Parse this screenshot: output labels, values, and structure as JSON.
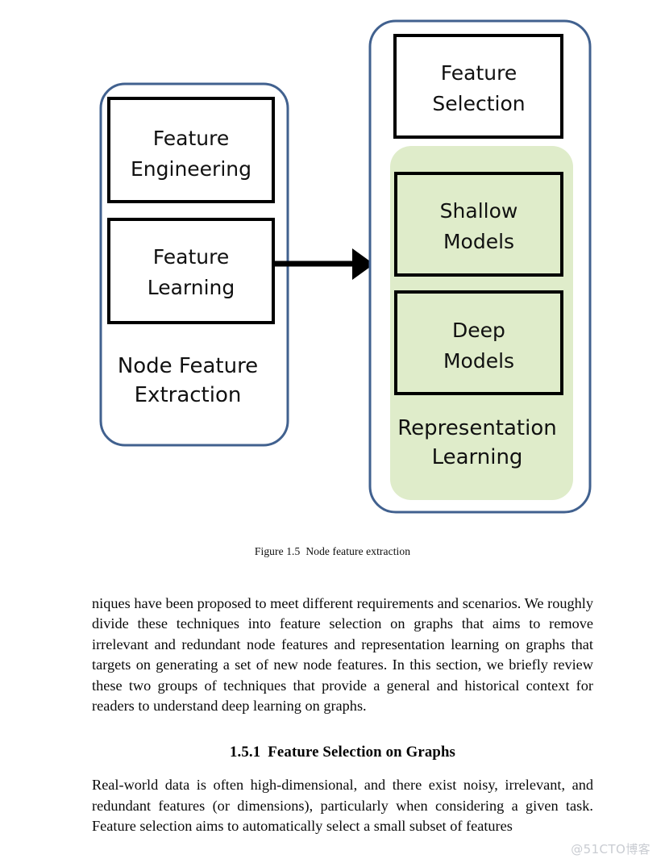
{
  "figure": {
    "caption_number": "Figure 1.5",
    "caption_text": "Node feature extraction",
    "colors": {
      "container_border": "#41618f",
      "group_fill": "#dfecca",
      "box_border": "#000000",
      "box_fill": "#ffffff",
      "arrow": "#000000"
    },
    "left_container": {
      "name": "Node Feature Extraction",
      "footer_label_line1": "Node Feature",
      "footer_label_line2": "Extraction",
      "boxes": [
        {
          "line1": "Feature",
          "line2": "Engineering"
        },
        {
          "line1": "Feature",
          "line2": "Learning"
        }
      ]
    },
    "right_container": {
      "boxes": [
        {
          "line1": "Feature",
          "line2": "Selection"
        }
      ],
      "group": {
        "footer_label_line1": "Representation",
        "footer_label_line2": "Learning",
        "boxes": [
          {
            "line1": "Shallow",
            "line2": "Models"
          },
          {
            "line1": "Deep",
            "line2": "Models"
          }
        ]
      }
    },
    "arrow": {
      "from": "Feature Learning",
      "to": "Representation Learning"
    }
  },
  "document": {
    "paragraph1": "niques have been proposed to meet different requirements and scenarios. We roughly divide these techniques into feature selection on graphs that aims to remove irrelevant and redundant node features and representation learning on graphs that targets on generating a set of new node features. In this section, we briefly review these two groups of techniques that provide a general and historical context for readers to understand deep learning on graphs.",
    "section_number": "1.5.1",
    "section_title": "Feature Selection on Graphs",
    "paragraph2": "Real-world data is often high-dimensional, and there exist noisy, irrelevant, and redundant features (or dimensions), particularly when considering a given task. Feature selection aims to automatically select a small subset of features"
  },
  "watermark": {
    "text": "@51CTO博客"
  }
}
